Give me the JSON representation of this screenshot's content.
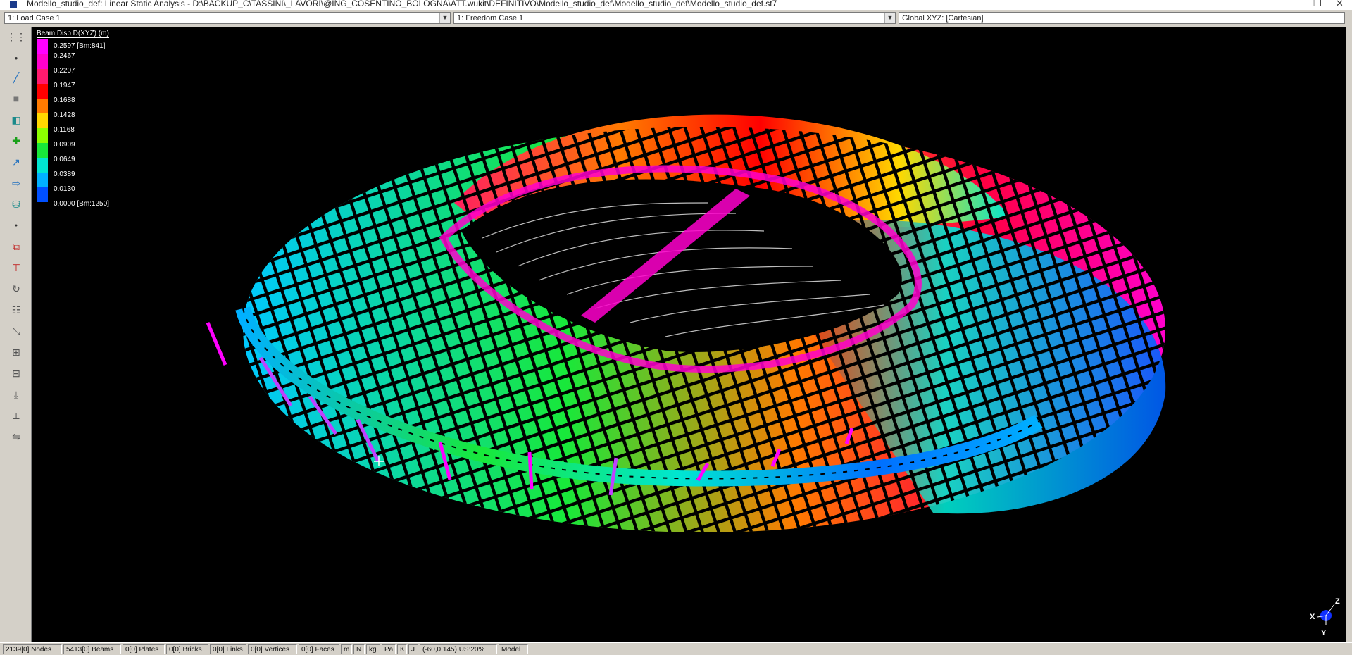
{
  "window": {
    "title": "Modello_studio_def: Linear Static Analysis - D:\\BACKUP_C\\TASSINI\\_LAVORI\\@ING_COSENTINO_BOLOGNA\\ATT.wukit\\DEFINITIVO\\Modello_studio_def\\Modello_studio_def\\Modello_studio_def.st7",
    "minimize": "–",
    "restore": "❐",
    "close": "✕"
  },
  "selectors": {
    "load_case": "1: Load Case 1",
    "freedom_case": "1: Freedom Case 1",
    "coordinate_system": "Global XYZ: [Cartesian]"
  },
  "toolbar": {
    "tools": [
      "grid-icon",
      "node-icon",
      "beam-icon",
      "plate-icon",
      "brick-icon",
      "attribute-icon",
      "link-icon",
      "move-icon",
      "cylinder-icon",
      "small-node-icon",
      "results-icon",
      "property-icon",
      "rotate-icon",
      "table-icon",
      "scale-icon",
      "split-icon",
      "subdivide-icon",
      "extend-icon"
    ]
  },
  "legend": {
    "title": "Beam Disp D(XYZ) (m)",
    "entries": [
      {
        "label": "0.2597 [Bm:841]",
        "color": "#ff00ff"
      },
      {
        "label": "0.2467",
        "color": "#ff00cc"
      },
      {
        "label": "0.2207",
        "color": "#ff1a6e"
      },
      {
        "label": "0.1947",
        "color": "#ff0000"
      },
      {
        "label": "0.1688",
        "color": "#ff7a00"
      },
      {
        "label": "0.1428",
        "color": "#ffd800"
      },
      {
        "label": "0.1168",
        "color": "#8cff00"
      },
      {
        "label": "0.0909",
        "color": "#18e83a"
      },
      {
        "label": "0.0649",
        "color": "#00e6d2"
      },
      {
        "label": "0.0389",
        "color": "#00b0ff"
      },
      {
        "label": "0.0130",
        "color": "#0050ff"
      },
      {
        "label": "0.0000 [Bm:1250]",
        "color": "#0000cc"
      }
    ]
  },
  "gizmo": {
    "x": "X",
    "y": "Y",
    "z": "Z"
  },
  "status": {
    "nodes": "2139[0] Nodes",
    "beams": "5413[0] Beams",
    "plates": "0[0] Plates",
    "bricks": "0[0] Bricks",
    "links": "0[0] Links",
    "vertices": "0[0] Vertices",
    "faces": "0[0] Faces",
    "unit_length": "m",
    "unit_force": "N",
    "unit_stress": "kg",
    "unit_energy": "Pa",
    "unit_temp": "K",
    "unit_time": "J",
    "view_angles": "(-60,0,145) US:20%",
    "mode": "Model"
  }
}
